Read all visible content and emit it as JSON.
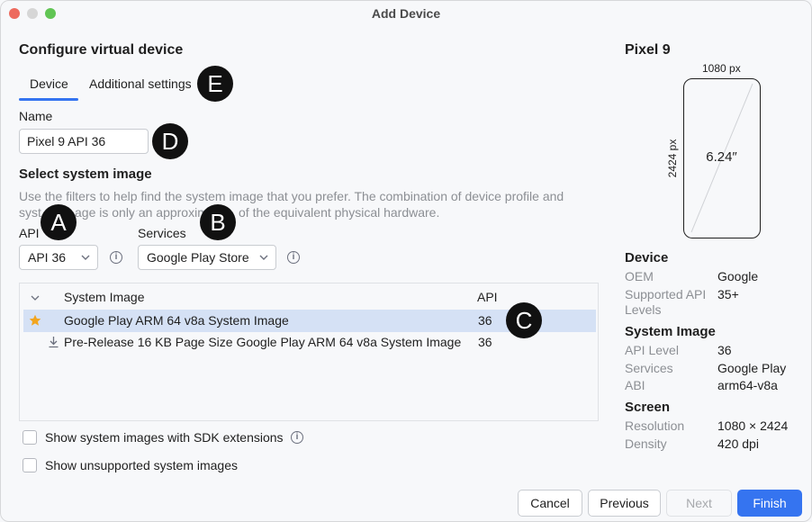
{
  "window": {
    "title": "Add Device"
  },
  "header": {
    "title": "Configure virtual device"
  },
  "tabs": [
    {
      "label": "Device",
      "selected": true
    },
    {
      "label": "Additional settings",
      "selected": false
    }
  ],
  "name_field": {
    "label": "Name",
    "value": "Pixel 9 API 36"
  },
  "system_image": {
    "heading": "Select system image",
    "help_line1": "Use the filters to help find the system image that you prefer. The combination of device profile and",
    "help_line2_left": "syst",
    "help_line2_mid": "age is only an approxim",
    "help_line2_right": "of the equivalent physical hardware.",
    "api_label": "API",
    "api_value": "API 36",
    "services_label": "Services",
    "services_value": "Google Play Store",
    "table": {
      "col_image": "System Image",
      "col_api": "API",
      "rows": [
        {
          "name": "Google Play ARM 64 v8a System Image",
          "api": "36",
          "icon": "star-icon",
          "selected": true
        },
        {
          "name": "Pre-Release 16 KB Page Size Google Play ARM 64 v8a System Image",
          "api": "36",
          "icon": "download-icon",
          "selected": false
        }
      ]
    },
    "checkbox_sdk": "Show system images with SDK extensions",
    "checkbox_unsupported": "Show unsupported system images"
  },
  "badges": {
    "a": "A",
    "b": "B",
    "c": "C",
    "d": "D",
    "e": "E"
  },
  "preview": {
    "device_name": "Pixel 9",
    "width_label": "1080 px",
    "height_label": "2424 px",
    "diagonal": "6.24″",
    "device_section": "Device",
    "oem_key": "OEM",
    "oem_value": "Google",
    "supported_key_line1": "Supported API",
    "supported_key_line2": "Levels",
    "supported_value": "35+",
    "image_section": "System Image",
    "api_level_key": "API Level",
    "api_level_value": "36",
    "services_key": "Services",
    "services_value": "Google Play",
    "abi_key": "ABI",
    "abi_value": "arm64-v8a",
    "screen_section": "Screen",
    "resolution_key": "Resolution",
    "resolution_value": "1080 × 2424",
    "density_key": "Density",
    "density_value": "420 dpi"
  },
  "buttons": {
    "cancel": "Cancel",
    "previous": "Previous",
    "next": "Next",
    "finish": "Finish"
  },
  "colors": {
    "accent": "#3574f0",
    "selection": "#d5e1f5",
    "star": "#f2a51f",
    "badge": "#111111"
  }
}
